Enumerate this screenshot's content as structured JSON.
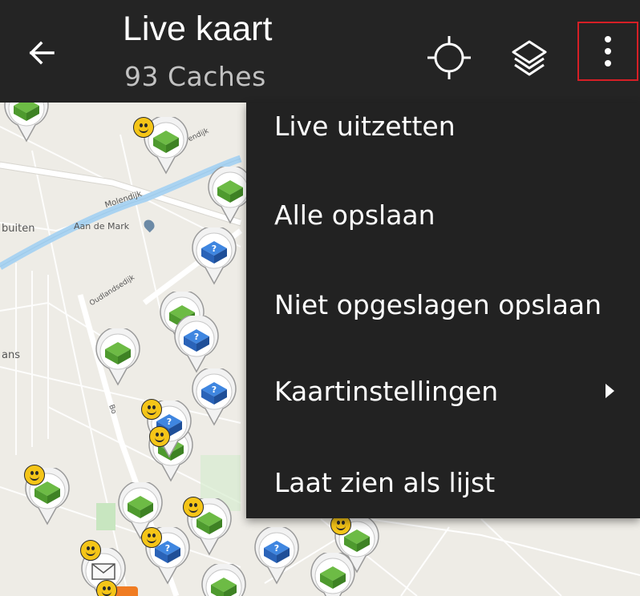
{
  "toolbar": {
    "title": "Live kaart",
    "subtitle": "93 Caches",
    "back_icon": "arrow-left-icon",
    "locate_icon": "crosshair-icon",
    "layers_icon": "layers-icon",
    "overflow_icon": "more-vert-icon",
    "background": "#242424",
    "highlight_color": "#d61f26"
  },
  "map": {
    "labels": {
      "molendijk": "Molendijk",
      "aan_de_mark": "Aan de Mark",
      "oudlandsedijk": "Oudlandsedijk",
      "buiten": "buiten",
      "ans": "ans",
      "endijk": "endijk",
      "bo": "Bo"
    },
    "cache_types": [
      "traditional",
      "mystery",
      "letterbox",
      "event"
    ],
    "colors": {
      "traditional": "#5aaa3a",
      "mystery": "#2e6fd0",
      "found_smiley": "#f5c518",
      "water": "#aad3f1"
    }
  },
  "menu": {
    "items": [
      {
        "label": "Live uitzetten"
      },
      {
        "label": "Alle opslaan"
      },
      {
        "label": "Niet opgeslagen opslaan"
      },
      {
        "label": "Kaartinstellingen",
        "has_submenu": true
      },
      {
        "label": "Laat zien als lijst"
      }
    ]
  }
}
